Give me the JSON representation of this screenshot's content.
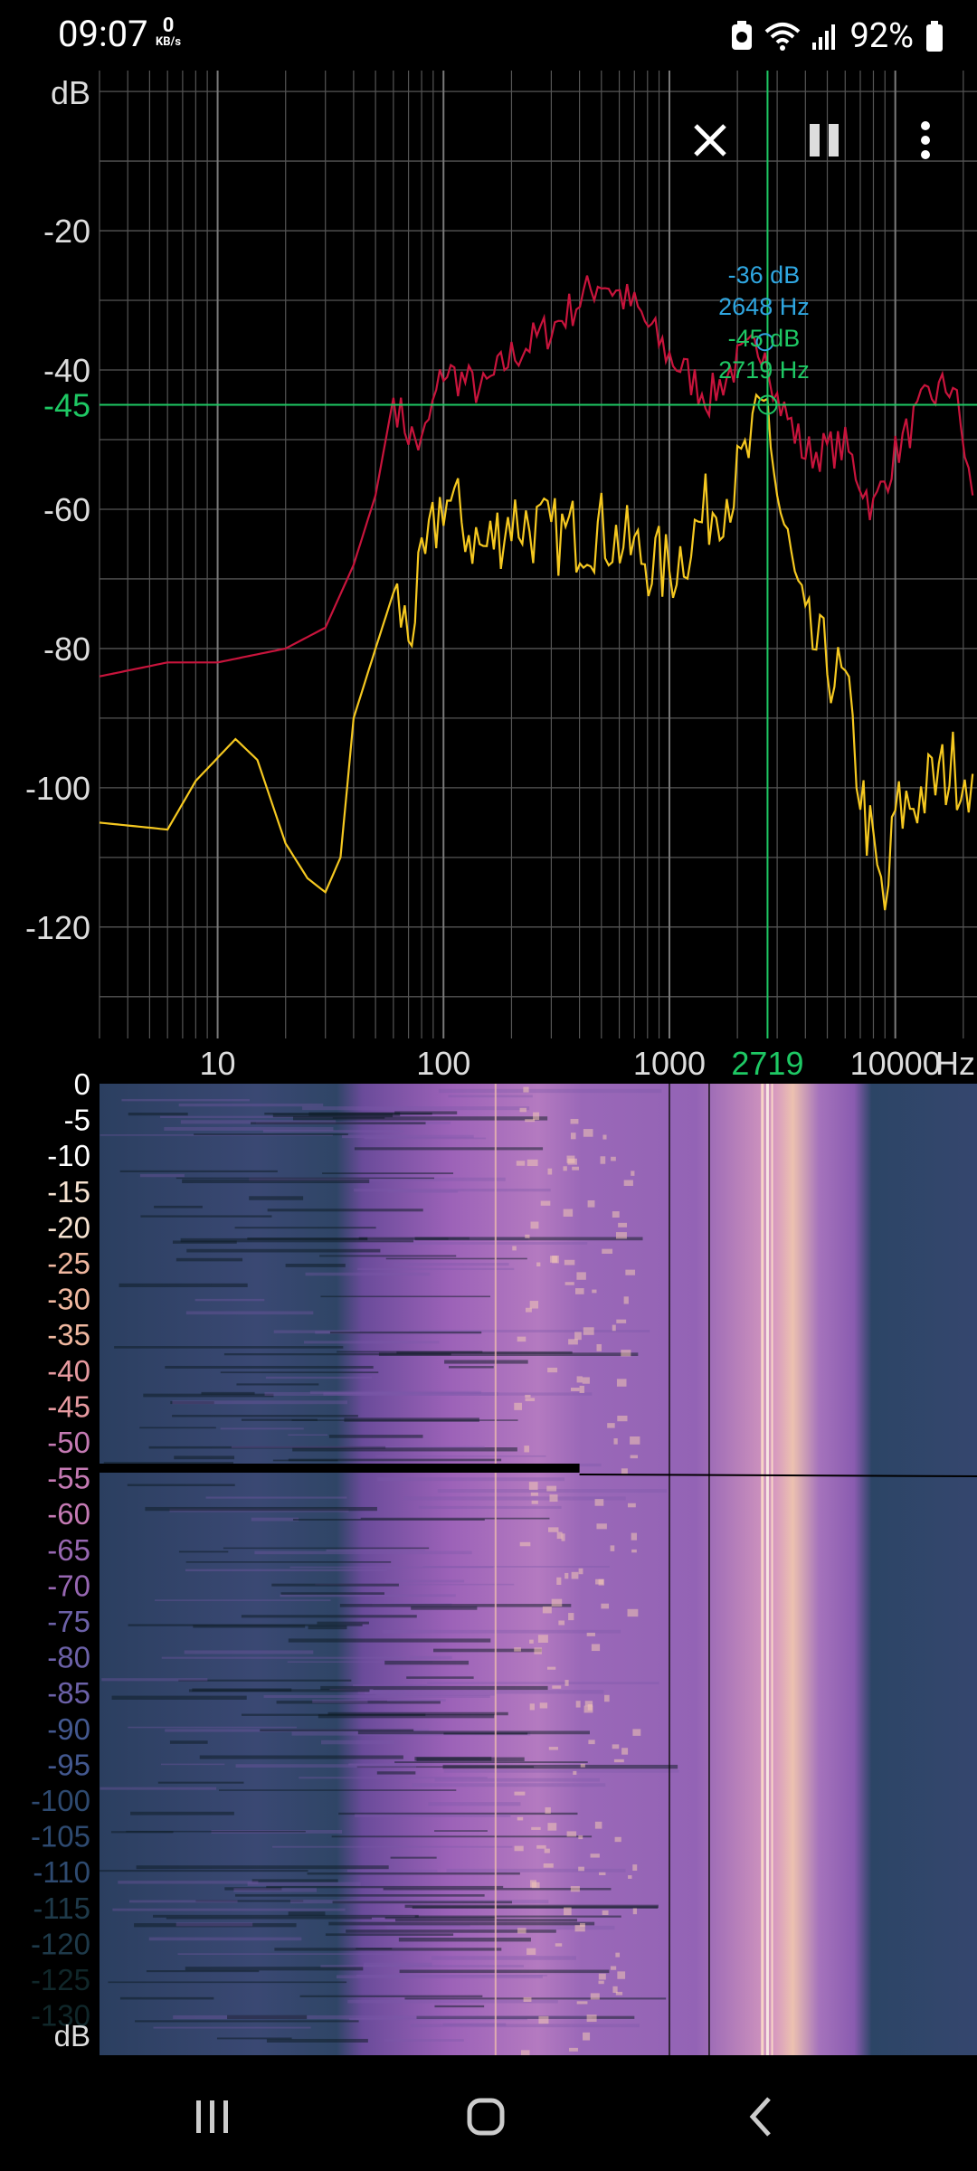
{
  "status_bar": {
    "time": "09:07",
    "net_speed_value": "0",
    "net_speed_unit": "KB/s",
    "battery_percent": "92%"
  },
  "toolbar": {
    "close_icon": "close-icon",
    "pause_icon": "pause-icon",
    "menu_icon": "more-vert-icon"
  },
  "spectrum": {
    "y_unit_label": "dB",
    "y_tick_labels": [
      "-20",
      "-40",
      "-60",
      "-80",
      "-100",
      "-120"
    ],
    "x_tick_labels": [
      "10",
      "100",
      "1000",
      "10000"
    ],
    "x_unit_label": "Hz",
    "cursor_freq_label": "2719",
    "cursor_db_label": "-45",
    "peak_readout": {
      "db": "-36 dB",
      "hz": "2648 Hz"
    },
    "cursor_readout": {
      "db": "-45 dB",
      "hz": "2719 Hz"
    }
  },
  "spectrogram": {
    "time_tick_labels": [
      "0",
      "-5",
      "-10",
      "-15",
      "-20",
      "-25",
      "-30",
      "-35",
      "-40",
      "-45",
      "-50",
      "-55",
      "-60",
      "-65",
      "-70",
      "-75",
      "-80",
      "-85",
      "-90",
      "-95",
      "-100",
      "-105",
      "-110",
      "-115",
      "-120",
      "-125",
      "-130"
    ],
    "db_label": "dB"
  },
  "colors": {
    "peak_hold": "#c8143c",
    "spectrum": "#f5c820",
    "cursor": "#1ec864",
    "peak_readout": "#2fa6e0",
    "grid": "#555555"
  },
  "chart_data": {
    "type": "line",
    "x_scale": "log",
    "x_range_hz": [
      3,
      23000
    ],
    "ylim": [
      -136,
      3
    ],
    "series": [
      {
        "x": [
          3,
          6,
          10,
          20,
          30,
          40,
          50,
          60,
          70,
          80,
          100,
          150,
          200,
          300,
          500,
          700,
          1000,
          1500,
          2000,
          2648,
          3000,
          4000,
          6000,
          8000,
          10000,
          14000,
          18000,
          22000
        ],
        "y": [
          -84,
          -82,
          -82,
          -80,
          -77,
          -68,
          -58,
          -44,
          -49,
          -51,
          -40,
          -43,
          -38,
          -34,
          -27,
          -31,
          -38,
          -44,
          -39,
          -36,
          -44,
          -52,
          -51,
          -60,
          -52,
          -44,
          -42,
          -58
        ]
      },
      {
        "x": [
          3,
          6,
          8,
          12,
          15,
          20,
          25,
          30,
          35,
          40,
          50,
          60,
          70,
          80,
          100,
          150,
          200,
          300,
          500,
          700,
          1000,
          1500,
          2000,
          2719,
          3000,
          4000,
          5000,
          6000,
          7000,
          8000,
          9000,
          10000,
          14000,
          18000,
          22000
        ],
        "y": [
          -105,
          -106,
          -99,
          -93,
          -96,
          -108,
          -113,
          -115,
          -110,
          -90,
          -80,
          -72,
          -78,
          -70,
          -58,
          -66,
          -61,
          -64,
          -63,
          -66,
          -69,
          -60,
          -56,
          -45,
          -58,
          -78,
          -82,
          -86,
          -100,
          -110,
          -118,
          -104,
          -100,
          -97,
          -98
        ]
      }
    ]
  }
}
